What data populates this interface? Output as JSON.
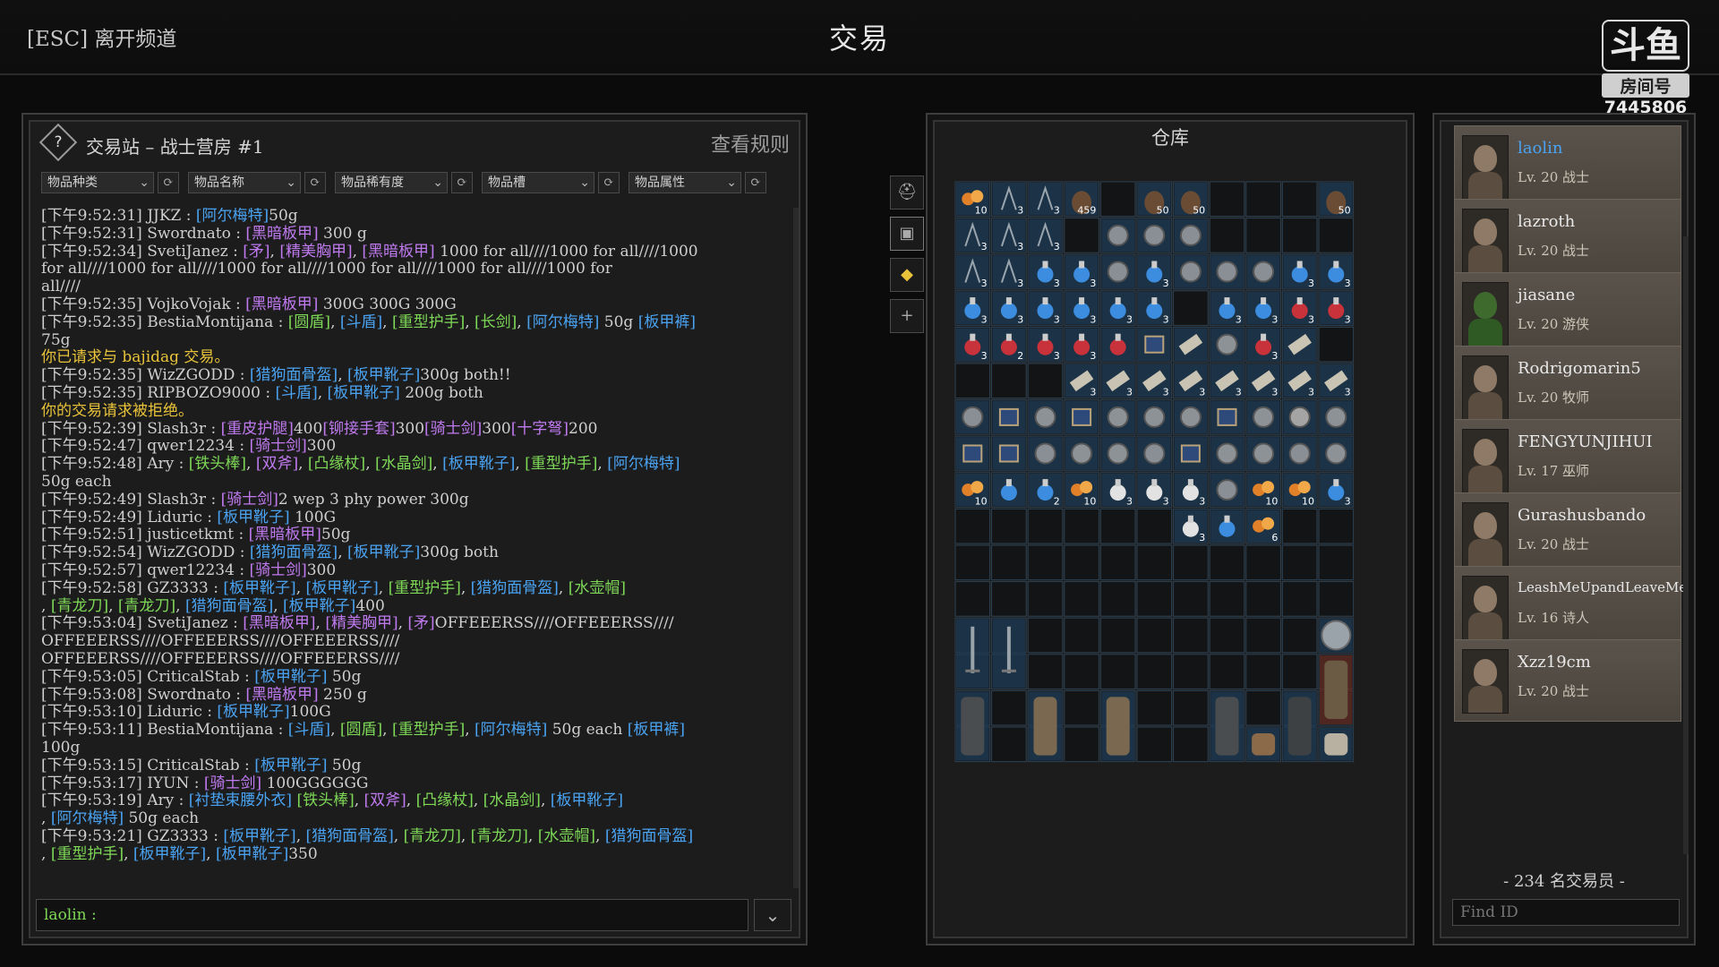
{
  "top": {
    "leave": "[ESC] 离开频道",
    "title": "交易",
    "watermark_logo": "斗鱼",
    "watermark_room": "房间号",
    "watermark_id": "7445806"
  },
  "chat": {
    "channel_title": "交易站 – 战士营房 #1",
    "rules": "查看规则",
    "help": "?",
    "filters": [
      "物品种类",
      "物品名称",
      "物品稀有度",
      "物品槽",
      "物品属性"
    ],
    "input_user": "laolin :",
    "lines": [
      {
        "cls": "tm",
        "t": "[下午9:52:31] JJKZ : [阿尔梅特]50g"
      },
      {
        "cls": "tm",
        "t": "[下午9:52:31] Swordnato : [黑暗板甲] 300 g"
      },
      {
        "cls": "tm",
        "t": "[下午9:52:34] SvetiJanez : [矛], [精美胸甲], [黑暗板甲] 1000 for all////1000 for all////1000"
      },
      {
        "cls": "tm",
        "t": "for all////1000 for all////1000 for all////1000 for all////1000 for all////1000 for"
      },
      {
        "cls": "tm",
        "t": "all////"
      },
      {
        "cls": "tm",
        "t": "[下午9:52:35] VojkoVojak : [黑暗板甲] 300G 300G 300G"
      },
      {
        "cls": "tm",
        "t": "[下午9:52:35] BestiaMontijana : [圆盾], [斗盾], [重型护手], [长剑], [阿尔梅特] 50g [板甲裤]"
      },
      {
        "cls": "tm",
        "t": "75g"
      },
      {
        "cls": "sys",
        "t": "你已请求与 bajidag 交易。"
      },
      {
        "cls": "tm",
        "t": "[下午9:52:35] WizZGODD : [猎狗面骨盔], [板甲靴子]300g both!!"
      },
      {
        "cls": "tm",
        "t": "[下午9:52:35] RIPBOZO9000 : [斗盾], [板甲靴子] 200g both"
      },
      {
        "cls": "sys",
        "t": "你的交易请求被拒绝。"
      },
      {
        "cls": "tm",
        "t": "[下午9:52:39] Slash3r : [重皮护腿]400[铆接手套]300[骑士剑]300[十字弩]200"
      },
      {
        "cls": "tm",
        "t": "[下午9:52:47] qwer12234 : [骑士剑]300"
      },
      {
        "cls": "tm",
        "t": "[下午9:52:48] Ary : [铁头棒], [双斧], [凸缘杖], [水晶剑], [板甲靴子], [重型护手], [阿尔梅特]"
      },
      {
        "cls": "tm",
        "t": "50g each"
      },
      {
        "cls": "tm",
        "t": "[下午9:52:49] Slash3r : [骑士剑]2 wep 3 phy power 300g"
      },
      {
        "cls": "tm",
        "t": "[下午9:52:49] Liduric : [板甲靴子] 100G"
      },
      {
        "cls": "tm",
        "t": "[下午9:52:51] justicetkmt : [黑暗板甲]50g"
      },
      {
        "cls": "tm",
        "t": "[下午9:52:54] WizZGODD : [猎狗面骨盔], [板甲靴子]300g both"
      },
      {
        "cls": "tm",
        "t": "[下午9:52:57] qwer12234 : [骑士剑]300"
      },
      {
        "cls": "tm",
        "t": "[下午9:52:58] GZ3333 : [板甲靴子], [板甲靴子], [重型护手], [猎狗面骨盔], [水壶帽]"
      },
      {
        "cls": "tm",
        "t": ", [青龙刀], [青龙刀], [猎狗面骨盔], [板甲靴子]400"
      },
      {
        "cls": "tm",
        "t": "[下午9:53:04] SvetiJanez : [黑暗板甲], [精美胸甲], [矛]OFFEEERSS////OFFEEERSS////"
      },
      {
        "cls": "tm",
        "t": "OFFEEERSS////OFFEEERSS////OFFEEERSS////"
      },
      {
        "cls": "tm",
        "t": "OFFEEERSS////OFFEEERSS////OFFEEERSS////"
      },
      {
        "cls": "tm",
        "t": "[下午9:53:05] CriticalStab : [板甲靴子] 50g"
      },
      {
        "cls": "tm",
        "t": "[下午9:53:08] Swordnato : [黑暗板甲] 250 g"
      },
      {
        "cls": "tm",
        "t": "[下午9:53:10] Liduric : [板甲靴子]100G"
      },
      {
        "cls": "tm",
        "t": "[下午9:53:11] BestiaMontijana : [斗盾], [圆盾], [重型护手], [阿尔梅特] 50g each [板甲裤]"
      },
      {
        "cls": "tm",
        "t": "100g"
      },
      {
        "cls": "tm",
        "t": "[下午9:53:15] CriticalStab : [板甲靴子] 50g"
      },
      {
        "cls": "tm",
        "t": "[下午9:53:17] IYUN : [骑士剑] 100GGGGGG"
      },
      {
        "cls": "tm",
        "t": "[下午9:53:19] Ary : [衬垫束腰外衣] [铁头棒], [双斧], [凸缘杖], [水晶剑], [板甲靴子]"
      },
      {
        "cls": "tm",
        "t": ", [阿尔梅特] 50g each"
      },
      {
        "cls": "tm",
        "t": "[下午9:53:21] GZ3333 : [板甲靴子], [猎狗面骨盔], [青龙刀], [青龙刀], [水壶帽], [猎狗面骨盔]"
      },
      {
        "cls": "tm",
        "t": ", [重型护手], [板甲靴子], [板甲靴子]350"
      }
    ]
  },
  "warehouse": {
    "title": "仓库",
    "rows": [
      [
        "orange:10",
        "thin:3",
        "thin:3",
        "bag:459",
        "",
        "bag:50",
        "bag:50",
        "",
        "",
        "",
        "bag:50"
      ],
      [
        "thin:3",
        "thin:3",
        "thin:3",
        "",
        "helm",
        "helm",
        "helm",
        "",
        "",
        "",
        ""
      ],
      [
        "thin:3",
        "thin:3",
        "blue:3",
        "blue:3",
        "helm",
        "blue:3",
        "helm",
        "helm",
        "helm",
        "blue:3",
        "blue:3"
      ],
      [
        "blue:3",
        "blue:3",
        "blue:3",
        "blue:3",
        "blue:3",
        "blue:3",
        "",
        "blue:3",
        "blue:3",
        "red:3",
        "red:3"
      ],
      [
        "red:3",
        "red:2",
        "red:3",
        "red:3",
        "red",
        "book",
        "scroll",
        "coin",
        "red:3",
        "scroll",
        ""
      ],
      [
        "",
        "",
        "",
        "scroll:3",
        "scroll:3",
        "scroll:3",
        "scroll:3",
        "scroll:3",
        "scroll:3",
        "scroll:3",
        "scroll:3"
      ],
      [
        "helm",
        "book",
        "coin",
        "book",
        "coin",
        "coin",
        "coin",
        "book",
        "coin",
        "ring",
        "coin"
      ],
      [
        "book",
        "book",
        "helm",
        "coin",
        "coin",
        "helm",
        "book",
        "coin",
        "coin",
        "helm",
        "coin"
      ],
      [
        "orange:10",
        "blue",
        "blue:2",
        "orange:10",
        "white:3",
        "white:3",
        "white:3",
        "helm",
        "orange:10",
        "orange:10",
        "blue:3"
      ],
      [
        "",
        "",
        "",
        "",
        "",
        "",
        "white:3",
        "blue",
        "orange:6",
        "",
        ""
      ],
      [
        "",
        "",
        "",
        "",
        "",
        "",
        "",
        "",
        "",
        "",
        ""
      ],
      [
        "",
        "",
        "",
        "",
        "",
        "",
        "",
        "",
        "",
        "",
        ""
      ]
    ],
    "equip_labels": [
      "sword-icon",
      "sword-icon",
      "shield-icon",
      "armor-icon",
      "cloak-icon",
      "backpack-icon",
      "backpack-icon",
      "cloak-icon",
      "cloak-icon",
      "pants-icon",
      "backpack-icon",
      "backpack-icon",
      "backpack-icon",
      "backpack-icon",
      "arrows-icon"
    ]
  },
  "traders": {
    "count": "- 234 名交易员 -",
    "find_placeholder": "Find ID",
    "list": [
      {
        "name": "laolin",
        "level": "Lv. 20 战士",
        "me": true
      },
      {
        "name": "lazroth",
        "level": "Lv. 20 战士"
      },
      {
        "name": "jiasane",
        "level": "Lv. 20 游侠"
      },
      {
        "name": "Rodrigomarin5",
        "level": "Lv. 20 牧师"
      },
      {
        "name": "FENGYUNJIHUI",
        "level": "Lv. 17 巫师"
      },
      {
        "name": "Gurashusbando",
        "level": "Lv. 20 战士"
      },
      {
        "name": "LeashMeUpandLeaveMe",
        "level": "Lv. 16 诗人",
        "small": true
      },
      {
        "name": "Xzz19cm",
        "level": "Lv. 20 战士"
      }
    ]
  },
  "colors": {
    "blue_item": "#4aa3f2",
    "purple_item": "#c07af0",
    "green_item": "#7ed957",
    "system": "#e8c33a"
  }
}
